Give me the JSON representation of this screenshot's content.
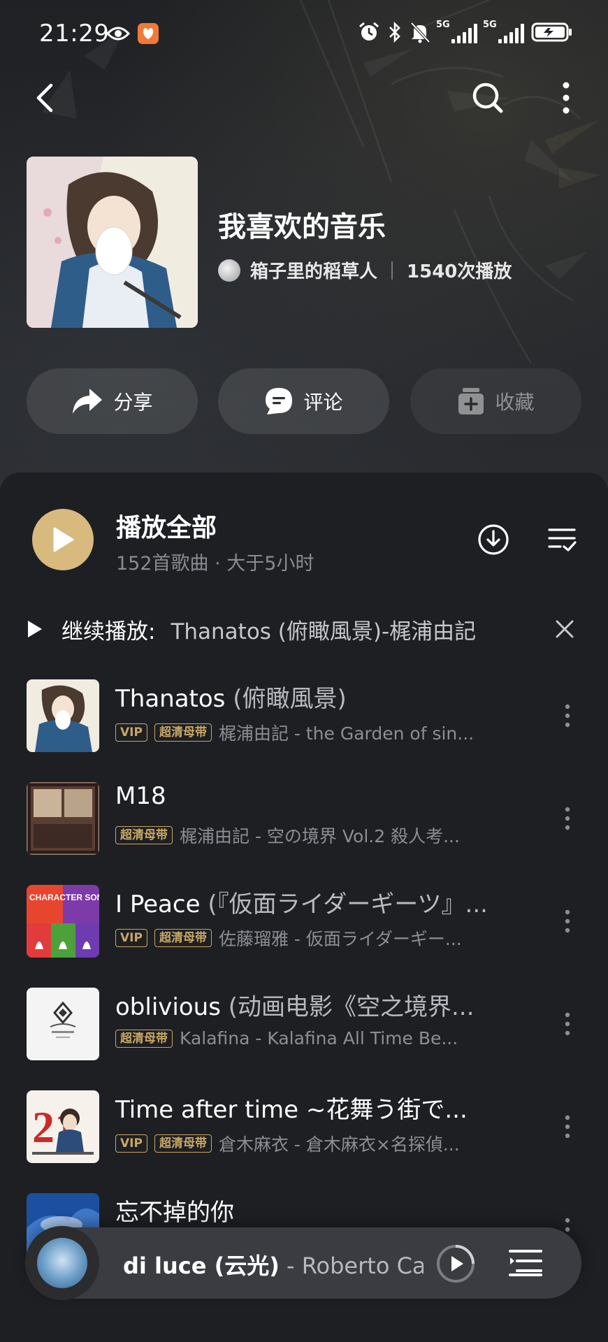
{
  "status_bar": {
    "time": "21:29"
  },
  "playlist": {
    "title": "我喜欢的音乐",
    "owner": "箱子里的稻草人",
    "play_count": "1540次播放"
  },
  "actions": {
    "share": "分享",
    "comment": "评论",
    "collect": "收藏"
  },
  "play_all": {
    "title": "播放全部",
    "subtitle": "152首歌曲 · 大于5小时"
  },
  "resume": {
    "label": "继续播放:",
    "track": "Thanatos (俯瞰風景)-梶浦由記"
  },
  "tags": {
    "vip": "VIP",
    "hq": "超清母带"
  },
  "songs": [
    {
      "title": "Thanatos",
      "paren": "(俯瞰風景)",
      "meta": "梶浦由記 - the Garden of sin..."
    },
    {
      "title": "M18",
      "paren": "",
      "meta": "梶浦由記 - 空の境界 Vol.2 殺人考..."
    },
    {
      "title": "I Peace",
      "paren": "(『仮面ライダーギーツ』...",
      "meta": "佐藤瑠雅 - 仮面ライダーギー..."
    },
    {
      "title": "oblivious",
      "paren": "(动画电影《空之境界...",
      "meta": "Kalafina - Kalafina All Time Be..."
    },
    {
      "title": "Time after time ~花舞う街で...",
      "paren": "",
      "meta": "倉木麻衣 - 倉木麻衣×名探偵..."
    },
    {
      "title": "忘不掉的你",
      "paren": "",
      "meta": ""
    }
  ],
  "covers": {
    "song3": "CHARACTER SONG ALBUM",
    "song5": "21"
  },
  "mini_player": {
    "song": "di luce (云光)",
    "artist": " - Roberto Cacc"
  },
  "colors": {
    "accent": "#d8b97e",
    "tag": "#c7a766",
    "background": "#1e1f23"
  }
}
